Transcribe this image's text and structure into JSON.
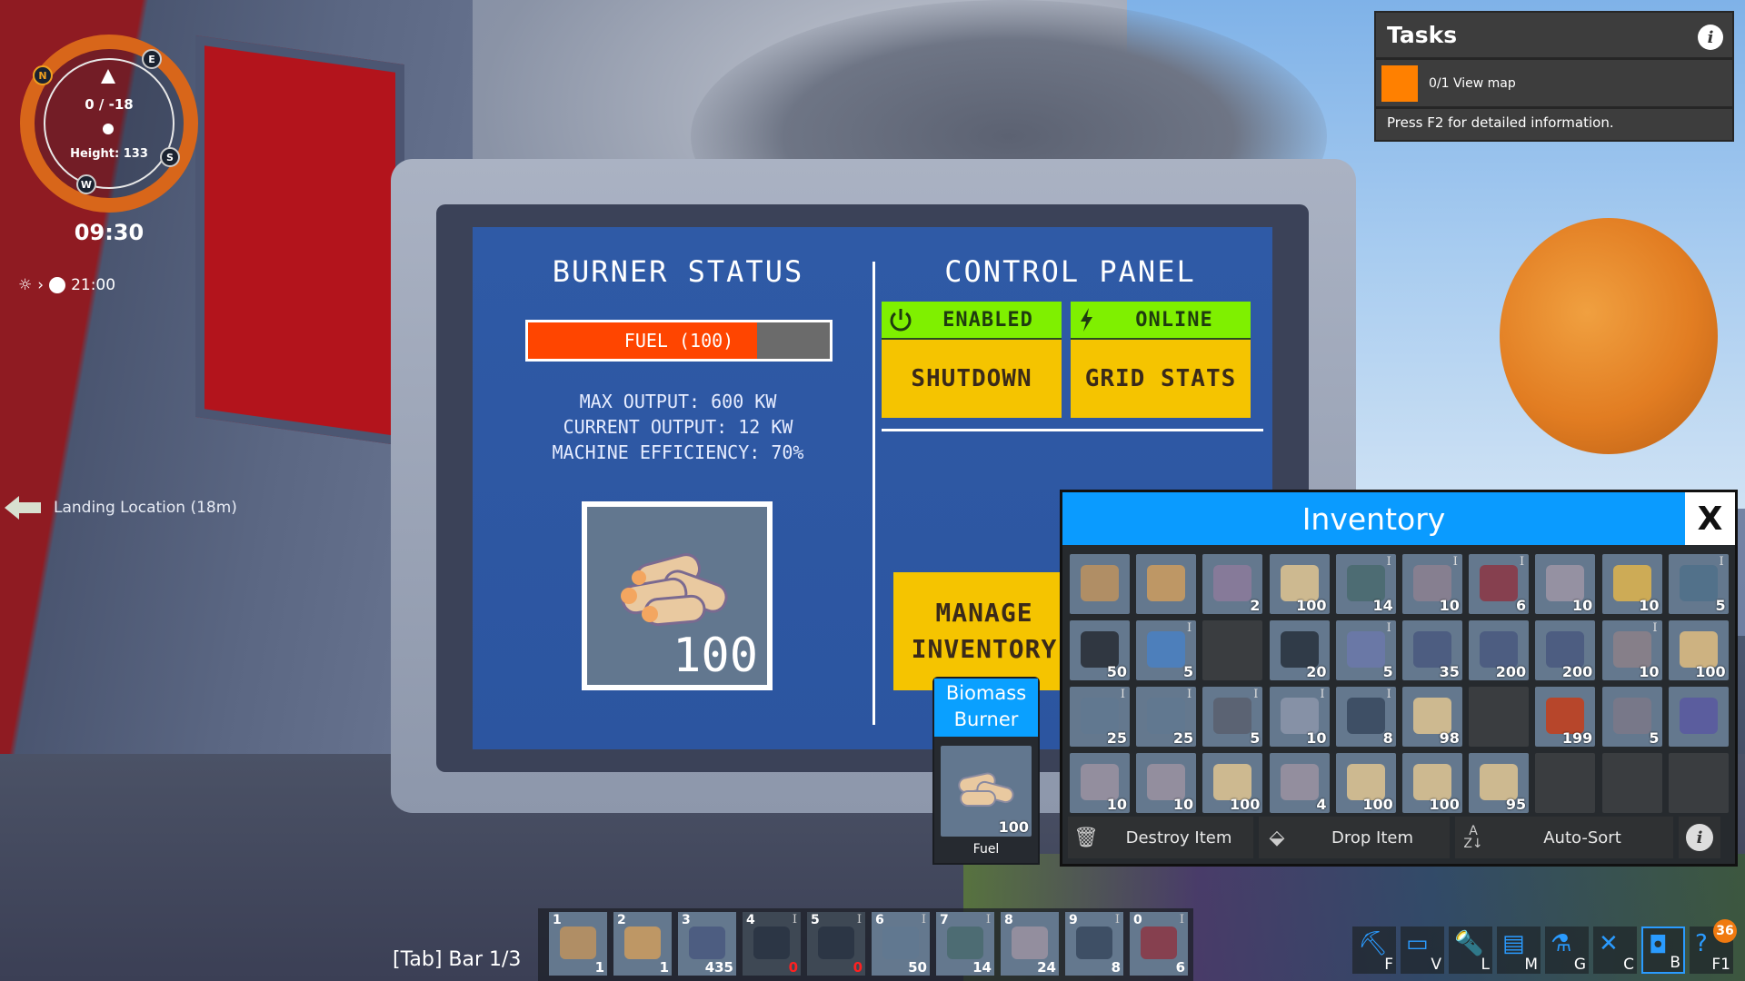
{
  "hud": {
    "compass": {
      "coords": "0 / -18",
      "height": "Height: 133",
      "directions": [
        "N",
        "E",
        "S",
        "W"
      ]
    },
    "clock": "09:30",
    "day_cycle": {
      "next_time": "21:00",
      "from_icon": "sun-icon",
      "to_icon": "moon-icon"
    },
    "waypoint": {
      "label": "Landing Location (18m)",
      "icon": "arrow-left-icon"
    }
  },
  "tasks": {
    "title": "Tasks",
    "items": [
      {
        "progress": "0/1",
        "label": "0/1 View map",
        "color": "#ff8000"
      }
    ],
    "footer": "Press F2 for detailed information."
  },
  "burner_status": {
    "title": "BURNER STATUS",
    "fuel_label": "FUEL (100)",
    "fuel_fraction": 0.76,
    "fuel_color": "#ff4500",
    "max_output": "MAX OUTPUT: 600 KW",
    "current_output": "CURRENT OUTPUT: 12 KW",
    "efficiency": "MACHINE EFFICIENCY: 70%",
    "fuel_slot_count": "100"
  },
  "control_panel": {
    "title": "CONTROL PANEL",
    "enabled_status": "ENABLED",
    "online_status": "ONLINE",
    "shutdown_label": "SHUTDOWN",
    "grid_stats_label": "GRID STATS",
    "manage_label": "MANAGE\nINVENTORY",
    "status_color": "#7ff000",
    "button_color": "#f5c400"
  },
  "machine_card": {
    "title": "Biomass Burner",
    "slot_count": "100",
    "slot_label": "Fuel"
  },
  "inventory": {
    "title": "Inventory",
    "close_label": "X",
    "slots": [
      {
        "count": "",
        "tier": "",
        "color": "#b89060"
      },
      {
        "count": "",
        "tier": "",
        "color": "#c89a60"
      },
      {
        "count": "2",
        "tier": "",
        "color": "#8a7a9a"
      },
      {
        "count": "100",
        "tier": "",
        "color": "#d8c090"
      },
      {
        "count": "14",
        "tier": "I",
        "color": "#4a6a70"
      },
      {
        "count": "10",
        "tier": "I",
        "color": "#8a8090"
      },
      {
        "count": "6",
        "tier": "I",
        "color": "#8a3a48"
      },
      {
        "count": "10",
        "tier": "",
        "color": "#9a94a4"
      },
      {
        "count": "10",
        "tier": "",
        "color": "#d8b050"
      },
      {
        "count": "5",
        "tier": "I",
        "color": "#50708a"
      },
      {
        "count": "50",
        "tier": "",
        "color": "#2a3038"
      },
      {
        "count": "5",
        "tier": "I",
        "color": "#4a80c0"
      },
      {
        "count": null,
        "tier": "",
        "color": null
      },
      {
        "count": "20",
        "tier": "",
        "color": "#2a3440"
      },
      {
        "count": "5",
        "tier": "I",
        "color": "#6a78a8"
      },
      {
        "count": "35",
        "tier": "",
        "color": "#4a5a80"
      },
      {
        "count": "200",
        "tier": "",
        "color": "#4a5a80"
      },
      {
        "count": "200",
        "tier": "",
        "color": "#4a5a80"
      },
      {
        "count": "10",
        "tier": "I",
        "color": "#8a8088"
      },
      {
        "count": "100",
        "tier": "",
        "color": "#d8b880"
      },
      {
        "count": "25",
        "tier": "I",
        "color": "#607890"
      },
      {
        "count": "25",
        "tier": "I",
        "color": "#607890"
      },
      {
        "count": "5",
        "tier": "I",
        "color": "#5a6070"
      },
      {
        "count": "10",
        "tier": "I",
        "color": "#8a94a8"
      },
      {
        "count": "8",
        "tier": "I",
        "color": "#3a4a60"
      },
      {
        "count": "98",
        "tier": "",
        "color": "#d8c090"
      },
      {
        "count": null,
        "tier": "",
        "color": null
      },
      {
        "count": "199",
        "tier": "",
        "color": "#c04020"
      },
      {
        "count": "5",
        "tier": "",
        "color": "#7a7888"
      },
      {
        "count": "",
        "tier": "",
        "color": "#5a5aa0"
      },
      {
        "count": "10",
        "tier": "",
        "color": "#9890a0"
      },
      {
        "count": "10",
        "tier": "",
        "color": "#9890a0"
      },
      {
        "count": "100",
        "tier": "",
        "color": "#d8c090"
      },
      {
        "count": "4",
        "tier": "",
        "color": "#9890a0"
      },
      {
        "count": "100",
        "tier": "",
        "color": "#d8c090"
      },
      {
        "count": "100",
        "tier": "",
        "color": "#d8c090"
      },
      {
        "count": "95",
        "tier": "",
        "color": "#d8c090"
      },
      {
        "count": null,
        "tier": "",
        "color": null
      },
      {
        "count": null,
        "tier": "",
        "color": null
      },
      {
        "count": null,
        "tier": "",
        "color": null
      }
    ],
    "actions": {
      "destroy_label": "Destroy Item",
      "drop_label": "Drop Item",
      "sort_label": "Auto-Sort"
    }
  },
  "hotbar": {
    "label": "[Tab] Bar 1/3",
    "slots": [
      {
        "key": "1",
        "count": "1",
        "tier": "",
        "zero": false,
        "color": "#b89060"
      },
      {
        "key": "2",
        "count": "1",
        "tier": "",
        "zero": false,
        "color": "#c89a60"
      },
      {
        "key": "3",
        "count": "435",
        "tier": "",
        "zero": false,
        "color": "#4a5a80"
      },
      {
        "key": "4",
        "count": "0",
        "tier": "I",
        "zero": true,
        "color": "#2a3444"
      },
      {
        "key": "5",
        "count": "0",
        "tier": "I",
        "zero": true,
        "color": "#2a3444"
      },
      {
        "key": "6",
        "count": "50",
        "tier": "I",
        "zero": false,
        "color": "#607890"
      },
      {
        "key": "7",
        "count": "14",
        "tier": "I",
        "zero": false,
        "color": "#4a6a70"
      },
      {
        "key": "8",
        "count": "24",
        "tier": "",
        "zero": false,
        "color": "#9890a0"
      },
      {
        "key": "9",
        "count": "8",
        "tier": "I",
        "zero": false,
        "color": "#3a4a60"
      },
      {
        "key": "0",
        "count": "6",
        "tier": "I",
        "zero": false,
        "color": "#8a3a48"
      }
    ]
  },
  "tools": [
    {
      "key": "F",
      "icon": "build-excavator-icon",
      "glyph": "⛏"
    },
    {
      "key": "V",
      "icon": "blueprint-icon",
      "glyph": "▭"
    },
    {
      "key": "L",
      "icon": "flashlight-icon",
      "glyph": "🔦"
    },
    {
      "key": "M",
      "icon": "map-icon",
      "glyph": "▤"
    },
    {
      "key": "G",
      "icon": "research-flask-icon",
      "glyph": "⚗"
    },
    {
      "key": "C",
      "icon": "crafting-tools-icon",
      "glyph": "✕"
    },
    {
      "key": "B",
      "icon": "backpack-icon",
      "glyph": "◘",
      "active": true
    },
    {
      "key": "F1",
      "icon": "help-icon",
      "glyph": "?",
      "badge": "36"
    }
  ]
}
